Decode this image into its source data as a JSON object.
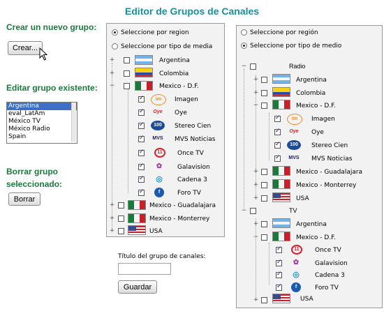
{
  "page_title": "Editor de Grupos de Canales",
  "left": {
    "create_title": "Crear un nuevo grupo:",
    "create_button": "Crear...",
    "edit_title": "Editar grupo existente:",
    "groups": [
      "Argentina",
      "eval_LatAm",
      "México TV",
      "México Radio",
      "Spain"
    ],
    "selected_group": "Argentina",
    "delete_title_line1": "Borrar grupo",
    "delete_title_line2": "seleccionado:",
    "delete_button": "Borrar"
  },
  "left_panel": {
    "radio_region": "Seleccione por region",
    "radio_media": "Seleccione por tipo de media",
    "items": [
      "Argentina",
      "Colombia",
      "Mexico - D.F.",
      "Imagen",
      "Oye",
      "Stereo Cien",
      "MVS Noticias",
      "Once TV",
      "Galavision",
      "Cadena 3",
      "Foro TV",
      "Mexico - Guadalajara",
      "Mexico - Monterrey",
      "USA"
    ]
  },
  "right_panel": {
    "radio_region": "Seleccione por región",
    "radio_media": "Seleccione por tipo de medio",
    "items": [
      "Radio",
      "Argentina",
      "Colombia",
      "Mexico - D.F.",
      "Imagen",
      "Oye",
      "Stereo Cien",
      "MVS Noticias",
      "Mexico - Guadalajara",
      "Mexico - Monterrey",
      "USA",
      "TV",
      "Argentina",
      "Mexico - D.F.",
      "Once TV",
      "Galavision",
      "Cadena 3",
      "Foro TV",
      "USA"
    ]
  },
  "form": {
    "group_title_label": "Título del grupo de canales:",
    "group_title_value": "",
    "save_button": "Guardar"
  },
  "colors": {
    "title": "#1a8f9a",
    "section_title": "#1a7a3e",
    "selection": "#3d6fc6"
  }
}
